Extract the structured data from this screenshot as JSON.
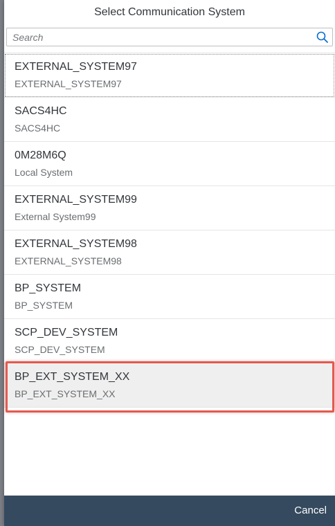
{
  "dialog": {
    "title": "Select Communication System"
  },
  "search": {
    "placeholder": "Search",
    "value": ""
  },
  "systems": [
    {
      "id": "EXTERNAL_SYSTEM97",
      "description": "EXTERNAL_SYSTEM97"
    },
    {
      "id": "SACS4HC",
      "description": "SACS4HC"
    },
    {
      "id": "0M28M6Q",
      "description": "Local System"
    },
    {
      "id": "EXTERNAL_SYSTEM99",
      "description": "External System99"
    },
    {
      "id": "EXTERNAL_SYSTEM98",
      "description": "EXTERNAL_SYSTEM98"
    },
    {
      "id": "BP_SYSTEM",
      "description": "BP_SYSTEM"
    },
    {
      "id": "SCP_DEV_SYSTEM",
      "description": "SCP_DEV_SYSTEM"
    },
    {
      "id": "BP_EXT_SYSTEM_XX",
      "description": "BP_EXT_SYSTEM_XX"
    }
  ],
  "footer": {
    "cancel_label": "Cancel"
  },
  "colors": {
    "footer_bg": "#354a5f",
    "highlight": "#e25a4f",
    "selected_row": "#efefef"
  },
  "icons": {
    "search": "search-icon"
  }
}
